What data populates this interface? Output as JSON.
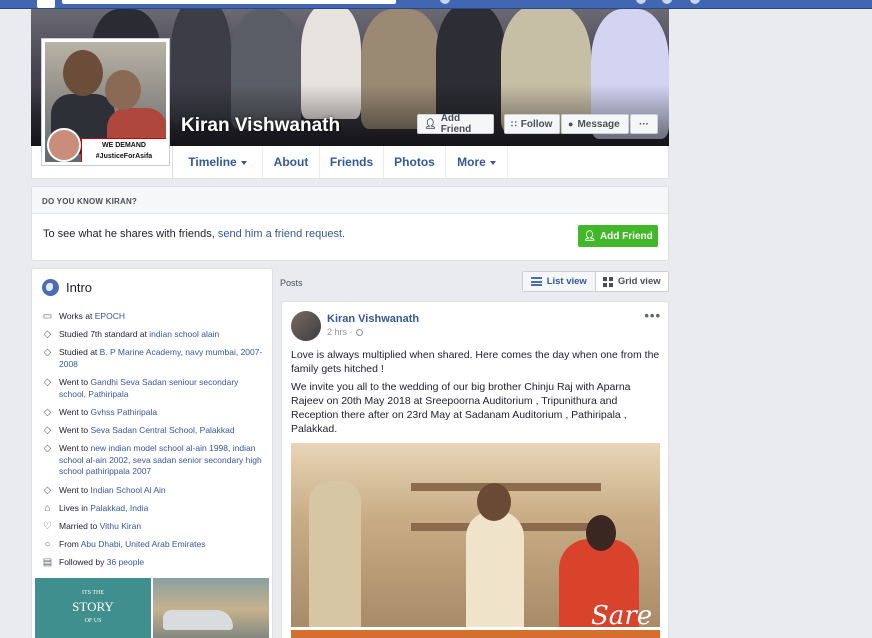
{
  "profile": {
    "name": "Kiran Vishwanath",
    "badge_line1": "WE DEMAND",
    "badge_line2": "#JusticeForAsifa"
  },
  "cover_buttons": {
    "add_friend": "Add Friend",
    "follow": "Follow",
    "message": "Message",
    "more": "···"
  },
  "tabs": [
    {
      "label": "Timeline",
      "has_caret": true
    },
    {
      "label": "About"
    },
    {
      "label": "Friends"
    },
    {
      "label": "Photos"
    },
    {
      "label": "More",
      "has_caret": true
    }
  ],
  "know_box": {
    "header": "DO YOU KNOW KIRAN?",
    "text_prefix": "To see what he shares with friends, ",
    "link": "send him a friend request.",
    "button": "Add Friend"
  },
  "intro": {
    "title": "Intro",
    "items": [
      {
        "icon": "briefcase-icon",
        "glyph": "▭",
        "prefix": "Works at ",
        "link": "EPOCH",
        "suffix": ""
      },
      {
        "icon": "graduation-cap-icon",
        "glyph": "◇",
        "prefix": "Studied 7th standard at ",
        "link": "indian school alain",
        "suffix": ""
      },
      {
        "icon": "graduation-cap-icon",
        "glyph": "◇",
        "prefix": "Studied at ",
        "link": "B. P Marine Academy, navy mumbai, 2007-2008",
        "suffix": ""
      },
      {
        "icon": "graduation-cap-icon",
        "glyph": "◇",
        "prefix": "Went to ",
        "link": "Gandhi Seva Sadan seniour secondary school, Pathiripala",
        "suffix": ""
      },
      {
        "icon": "graduation-cap-icon",
        "glyph": "◇",
        "prefix": "Went to ",
        "link": "Gvhss Pathiripala",
        "suffix": ""
      },
      {
        "icon": "graduation-cap-icon",
        "glyph": "◇",
        "prefix": "Went to ",
        "link": "Seva Sadan Central School, Palakkad",
        "suffix": ""
      },
      {
        "icon": "graduation-cap-icon",
        "glyph": "◇",
        "prefix": "Went to ",
        "link": "new indian model school al-ain 1998, indian school al-ain 2002, seva sadan senior secondary high school pathirippala 2007",
        "suffix": ""
      },
      {
        "icon": "graduation-cap-icon",
        "glyph": "◇",
        "prefix": "Went to ",
        "link": "Indian School Al Ain",
        "suffix": ""
      },
      {
        "icon": "home-icon",
        "glyph": "⌂",
        "prefix": "Lives in ",
        "link": "Palakkad, India",
        "suffix": ""
      },
      {
        "icon": "heart-icon",
        "glyph": "♡",
        "prefix": "Married to ",
        "link": "Vithu Kiran",
        "suffix": ""
      },
      {
        "icon": "location-pin-icon",
        "glyph": "○",
        "prefix": "From ",
        "link": "Abu Dhabi, United Arab Emirates",
        "suffix": ""
      },
      {
        "icon": "rss-followers-icon",
        "glyph": "▤",
        "prefix": "Followed by ",
        "link": "36 people",
        "suffix": ""
      }
    ],
    "photo1_small": "ITS THE",
    "photo1_big": "STORY",
    "photo1_small2": "OF US"
  },
  "posts": {
    "label": "Posts",
    "list_view": "List view",
    "grid_view": "Grid view"
  },
  "post": {
    "author": "Kiran Vishwanath",
    "time": "2 hrs ·",
    "menu": "•••",
    "text1": "Love is always multiplied when shared. Here comes the day when one from the family gets hitched !",
    "text2": "We invite you all to the wedding of our big brother Chinju Raj with Aparna Rajeev on 20th May 2018 at Sreepoorna Auditorium , Tripunithura and Reception there after on 23rd May at Sadanam Auditorium , Pathiripala , Palakkad.",
    "photo_caption": "Sare"
  }
}
